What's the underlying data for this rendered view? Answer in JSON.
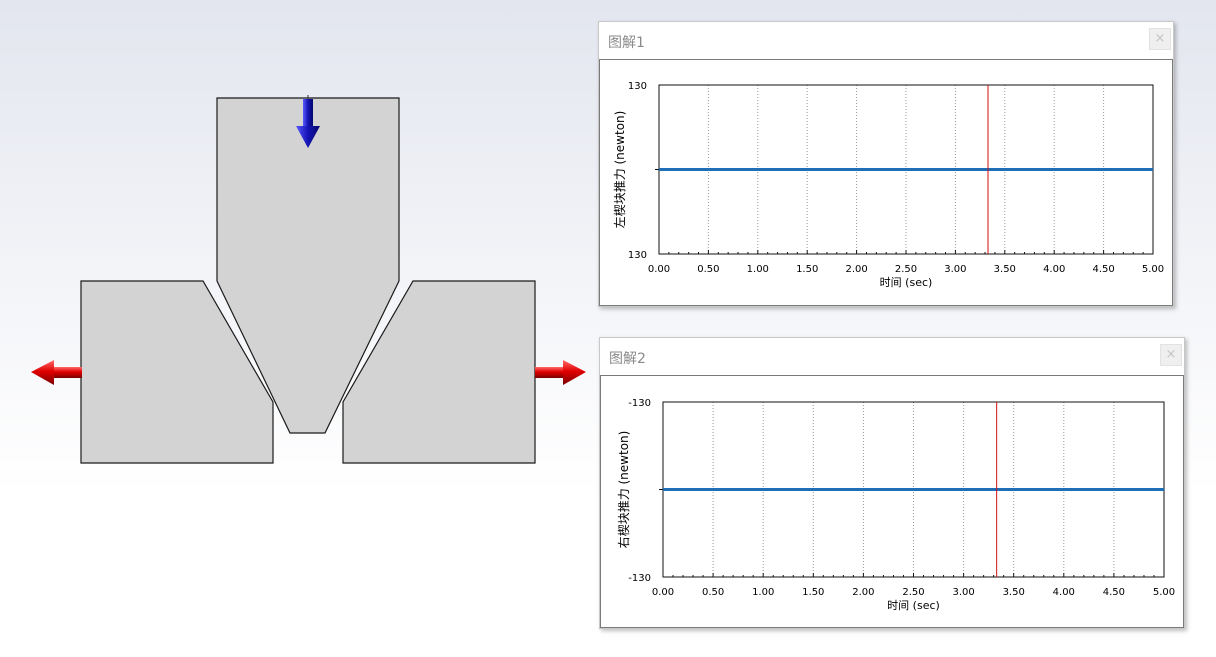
{
  "plots": [
    {
      "title": "图解1",
      "close_label": "×",
      "chart_data": {
        "type": "line",
        "ylabel": "左楔块推力 (newton)",
        "xlabel": "时间 (sec)",
        "xlim": [
          0,
          5
        ],
        "x_ticks": [
          "0.00",
          "0.50",
          "1.00",
          "1.50",
          "2.00",
          "2.50",
          "3.00",
          "3.50",
          "4.00",
          "4.50",
          "5.00"
        ],
        "y_tick_top": "130",
        "y_tick_bottom": "130",
        "series": [
          {
            "x": [
              0,
              5
            ],
            "y": [
              130,
              130
            ],
            "color": "#1f6fb6"
          }
        ],
        "cursor_x": 3.33,
        "cursor_color": "#d01010",
        "grid": "vertical-dotted"
      }
    },
    {
      "title": "图解2",
      "close_label": "×",
      "chart_data": {
        "type": "line",
        "ylabel": "右楔块推力 (newton)",
        "xlabel": "时间 (sec)",
        "xlim": [
          0,
          5
        ],
        "x_ticks": [
          "0.00",
          "0.50",
          "1.00",
          "1.50",
          "2.00",
          "2.50",
          "3.00",
          "3.50",
          "4.00",
          "4.50",
          "5.00"
        ],
        "y_tick_top": "-130",
        "y_tick_bottom": "-130",
        "series": [
          {
            "x": [
              0,
              5
            ],
            "y": [
              -130,
              -130
            ],
            "color": "#1f6fb6"
          }
        ],
        "cursor_x": 3.33,
        "cursor_color": "#d01010",
        "grid": "vertical-dotted"
      }
    }
  ],
  "model": {
    "part_fill": "#d3d3d3",
    "down_arrow_color": "#1a1aa8",
    "side_arrow_color": "#d40000"
  }
}
